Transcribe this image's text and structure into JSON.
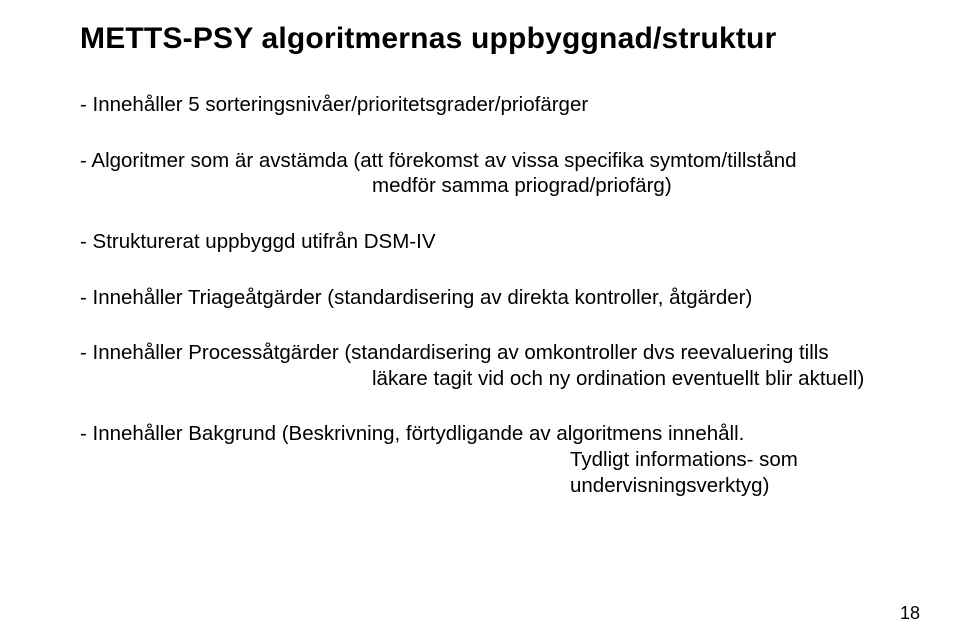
{
  "title": "METTS-PSY algoritmernas uppbyggnad/struktur",
  "items": {
    "i1": {
      "line1": "- Innehåller 5 sorteringsnivåer/prioritetsgrader/priofärger"
    },
    "i2": {
      "line1": "- Algoritmer som är avstämda (att förekomst av vissa specifika symtom/tillstånd",
      "indent": "medför samma priograd/priofärg)"
    },
    "i3": {
      "line1": "- Strukturerat uppbyggd utifrån DSM-IV"
    },
    "i4": {
      "line1": "- Innehåller Triageåtgärder (standardisering av direkta kontroller, åtgärder)"
    },
    "i5": {
      "line1": "- Innehåller Processåtgärder (standardisering av omkontroller dvs reevaluering tills",
      "indent": "läkare tagit vid och ny ordination eventuellt blir aktuell)"
    },
    "i6": {
      "line1": "- Innehåller Bakgrund (Beskrivning, förtydligande av algoritmens innehåll.",
      "indent": "Tydligt informations- som undervisningsverktyg)"
    }
  },
  "pageno": "18"
}
